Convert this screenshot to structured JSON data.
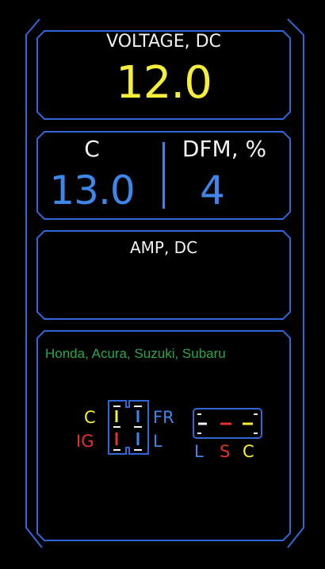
{
  "colors": {
    "frame": "#2f66d8",
    "voltage": "#f5ee3a",
    "value_blue": "#3f86ea",
    "label_white": "#f2f2f2",
    "makes_green": "#27a84a",
    "red": "#e4312b",
    "yellow": "#f5ee3a",
    "blue": "#3f86ea"
  },
  "voltage": {
    "label": "VOLTAGE, DC",
    "value": "12.0"
  },
  "temperature": {
    "label": "C",
    "value": "13.0"
  },
  "dfm": {
    "label": "DFM, %",
    "value": "4"
  },
  "amp": {
    "label": "AMP, DC",
    "value": ""
  },
  "connector": {
    "makes": "Honda, Acura, Suzuki, Subaru",
    "left_pins": {
      "c": "C",
      "ig": "IG",
      "fr": "FR",
      "l": "L"
    },
    "right_pins": {
      "l": "L",
      "s": "S",
      "c": "C"
    }
  }
}
